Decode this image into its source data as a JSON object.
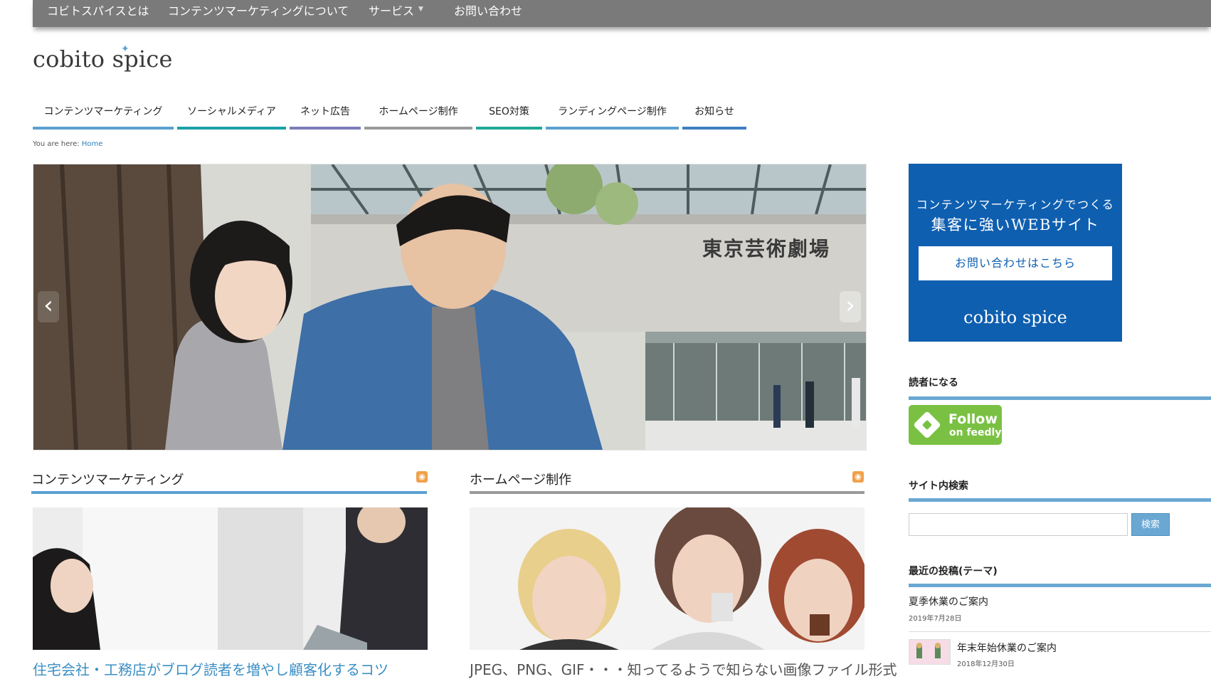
{
  "topnav": {
    "items": [
      "コビトスパイスとは",
      "コンテンツマーケティングについて",
      "サービス",
      "お問い合わせ"
    ],
    "service_caret": "▼"
  },
  "logo": {
    "text": "cobito spice",
    "star": "✦"
  },
  "category_nav": [
    {
      "label": "コンテンツマーケティング",
      "color": "#5ba0d0"
    },
    {
      "label": "ソーシャルメディア",
      "color": "#1aa0a8"
    },
    {
      "label": "ネット広告",
      "color": "#7d7db8"
    },
    {
      "label": "ホームページ制作",
      "color": "#9a9a9a"
    },
    {
      "label": "SEO対策",
      "color": "#1fa896"
    },
    {
      "label": "ランディングページ制作",
      "color": "#5ba0d0"
    },
    {
      "label": "お知らせ",
      "color": "#3f7fbf"
    }
  ],
  "breadcrumb": {
    "prefix": "You are here:",
    "home": "Home"
  },
  "hero": {
    "sign_text": "東京芸術劇場",
    "prev": "‹",
    "next": "›"
  },
  "sections": [
    {
      "title": "コンテンツマーケティング",
      "bar_color": "#5ba0d0",
      "rss": "◉",
      "post_title": "住宅会社・工務店がブログ読者を増やし顧客化するコツ",
      "post_color": "#3b8fc4"
    },
    {
      "title": "ホームページ制作",
      "bar_color": "#9a9a9a",
      "rss": "◉",
      "post_title": "JPEG、PNG、GIF・・・知ってるようで知らない画像ファイル形式",
      "post_color": "#555555"
    }
  ],
  "banner": {
    "line1": "コンテンツマーケティングでつくる",
    "line2": "集客に強いWEBサイト",
    "button": "お問い合わせはこちら",
    "logo": "cobito spice"
  },
  "sidebar": {
    "reader_title": "読者になる",
    "follow_main": "Follow",
    "follow_sub": "on feedly",
    "search_title": "サイト内検索",
    "search_button": "検索",
    "search_placeholder": "",
    "recent_title": "最近の投稿(テーマ)",
    "recent_posts": [
      {
        "title": "夏季休業のご案内",
        "date": "2019年7月28日"
      },
      {
        "title": "年末年始休業のご案内",
        "date": "2018年12月30日"
      }
    ]
  },
  "colors": {
    "accent": "#6aa8d2",
    "banner": "#0f5fb0",
    "feedly": "#7ac143"
  }
}
